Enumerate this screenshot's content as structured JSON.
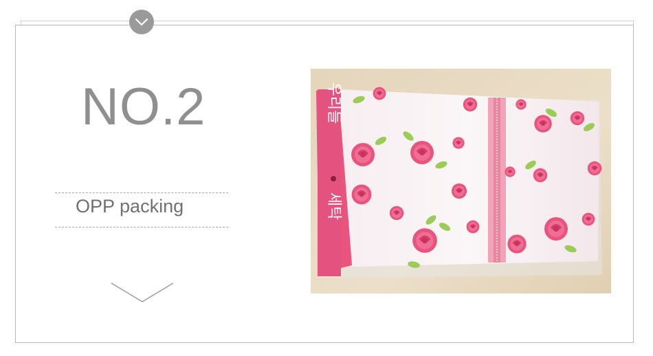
{
  "header": {
    "badge_icon": "chevron-down-icon"
  },
  "section": {
    "number": "NO.2",
    "caption": "OPP packing",
    "bottom_icon": "chevron-down-icon"
  },
  "photo": {
    "label_vertical_top": "우리들",
    "label_vertical_bottom": "세탁",
    "colors": {
      "accent": "#e8547e",
      "background": "#e9dcc4"
    }
  }
}
